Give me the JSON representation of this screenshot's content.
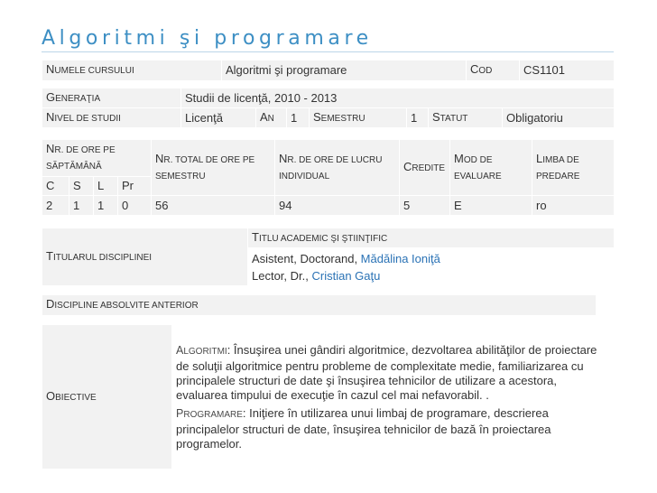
{
  "page": {
    "title": "Algoritmi şi programare"
  },
  "course": {
    "name_label_first": "N",
    "name_label_rest": "UMELE CURSULUI",
    "name_value": "Algoritmi şi programare",
    "code_label_first": "C",
    "code_label_rest": "OD",
    "code_value": "CS1101"
  },
  "generation": {
    "label_first": "G",
    "label_rest": "ENERAŢIA",
    "value": "Studii de licenţă, 2010 - 2013",
    "level_label_first": "N",
    "level_label_rest": "IVEL DE STUDII",
    "level_value": "Licenţă",
    "year_label_first": "A",
    "year_label_rest": "N",
    "year_value": "1",
    "semester_label_first": "S",
    "semester_label_rest": "EMESTRU",
    "semester_value": "1",
    "status_label_first": "S",
    "status_label_rest": "TATUT",
    "status_value": "Obligatoriu"
  },
  "hours": {
    "weekly_line1_first": "N",
    "weekly_line1_rest": "R. DE ORE PE",
    "weekly_line2": "SĂPTĂMÂNĂ",
    "total_first": "N",
    "total_rest": "R. TOTAL DE ORE PE SEMESTRU",
    "individual_first": "N",
    "individual_rest": "R. DE ORE DE LUCRU INDIVIDUAL",
    "credits_first": "C",
    "credits_rest": "REDITE",
    "eval_first": "M",
    "eval_rest": "OD DE EVALUARE",
    "lang_first": "L",
    "lang_rest": "IMBA DE PREDARE",
    "sub_c": "C",
    "sub_s": "S",
    "sub_l": "L",
    "sub_pr": "Pr",
    "val_c": "2",
    "val_s": "1",
    "val_l": "1",
    "val_pr": "0",
    "val_total": "56",
    "val_individual": "94",
    "val_credits": "5",
    "val_eval": "E",
    "val_lang": "ro"
  },
  "teachers": {
    "label_first": "T",
    "label_rest": "ITULARUL DISCIPLINEI",
    "academic_first": "T",
    "academic_rest": "ITLU ACADEMIC ŞI ŞTIINŢIFIC",
    "t1_prefix": "Asistent, Doctorand, ",
    "t1_name": "Mădălina Ioniţă",
    "t2_prefix": "Lector, Dr., ",
    "t2_name": "Cristian Gaţu"
  },
  "prerequisites": {
    "label_first": "D",
    "label_rest": "ISCIPLINE ABSOLVITE ANTERIOR"
  },
  "objectives": {
    "label_first": "O",
    "label_rest": "BIECTIVE",
    "p1_label_first": "A",
    "p1_label_rest": "LGORITMI",
    "p1_text": ": Însuşirea unei gândiri algoritmice, dezvoltarea abilităţilor de proiectare de soluţii algoritmice pentru probleme de complexitate medie, familiarizarea cu principalele structuri de date şi însuşirea tehnicilor de utilizare a acestora, evaluarea timpului de execuţie în cazul cel mai nefavorabil. .",
    "p2_label_first": "P",
    "p2_label_rest": "ROGRAMARE",
    "p2_text": ": Iniţiere în utilizarea unui limbaj de programare, descrierea principalelor structuri de date, însuşirea tehnicilor de bază în proiectarea programelor."
  }
}
